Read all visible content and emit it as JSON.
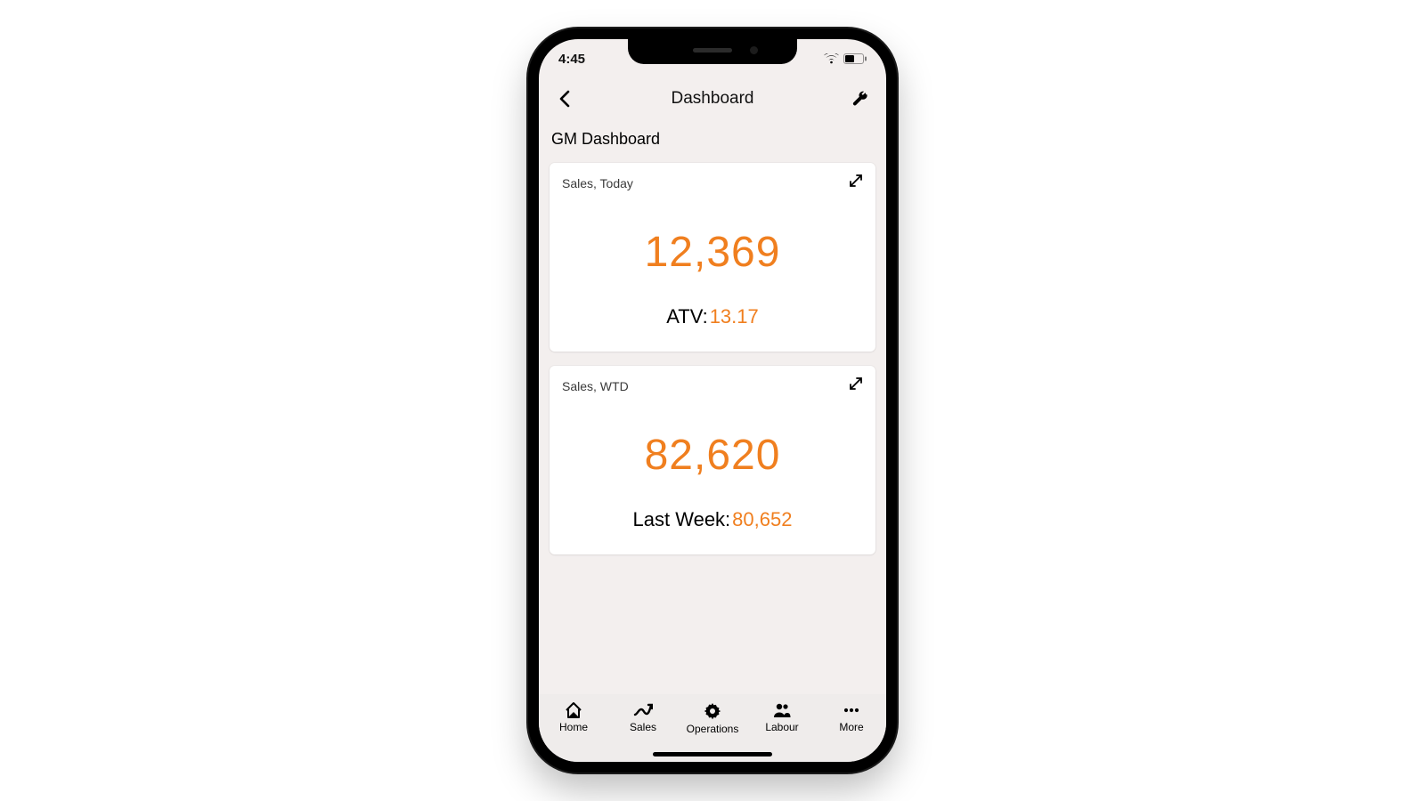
{
  "status": {
    "time": "4:45"
  },
  "header": {
    "title": "Dashboard"
  },
  "section": {
    "title": "GM Dashboard"
  },
  "cards": [
    {
      "title": "Sales, Today",
      "value": "12,369",
      "sublabel": "ATV:",
      "subvalue": "13.17"
    },
    {
      "title": "Sales, WTD",
      "value": "82,620",
      "sublabel": "Last Week:",
      "subvalue": "80,652"
    }
  ],
  "tabs": [
    {
      "label": "Home"
    },
    {
      "label": "Sales"
    },
    {
      "label": "Operations"
    },
    {
      "label": "Labour"
    },
    {
      "label": "More"
    }
  ],
  "colors": {
    "accent": "#f07f1f"
  }
}
